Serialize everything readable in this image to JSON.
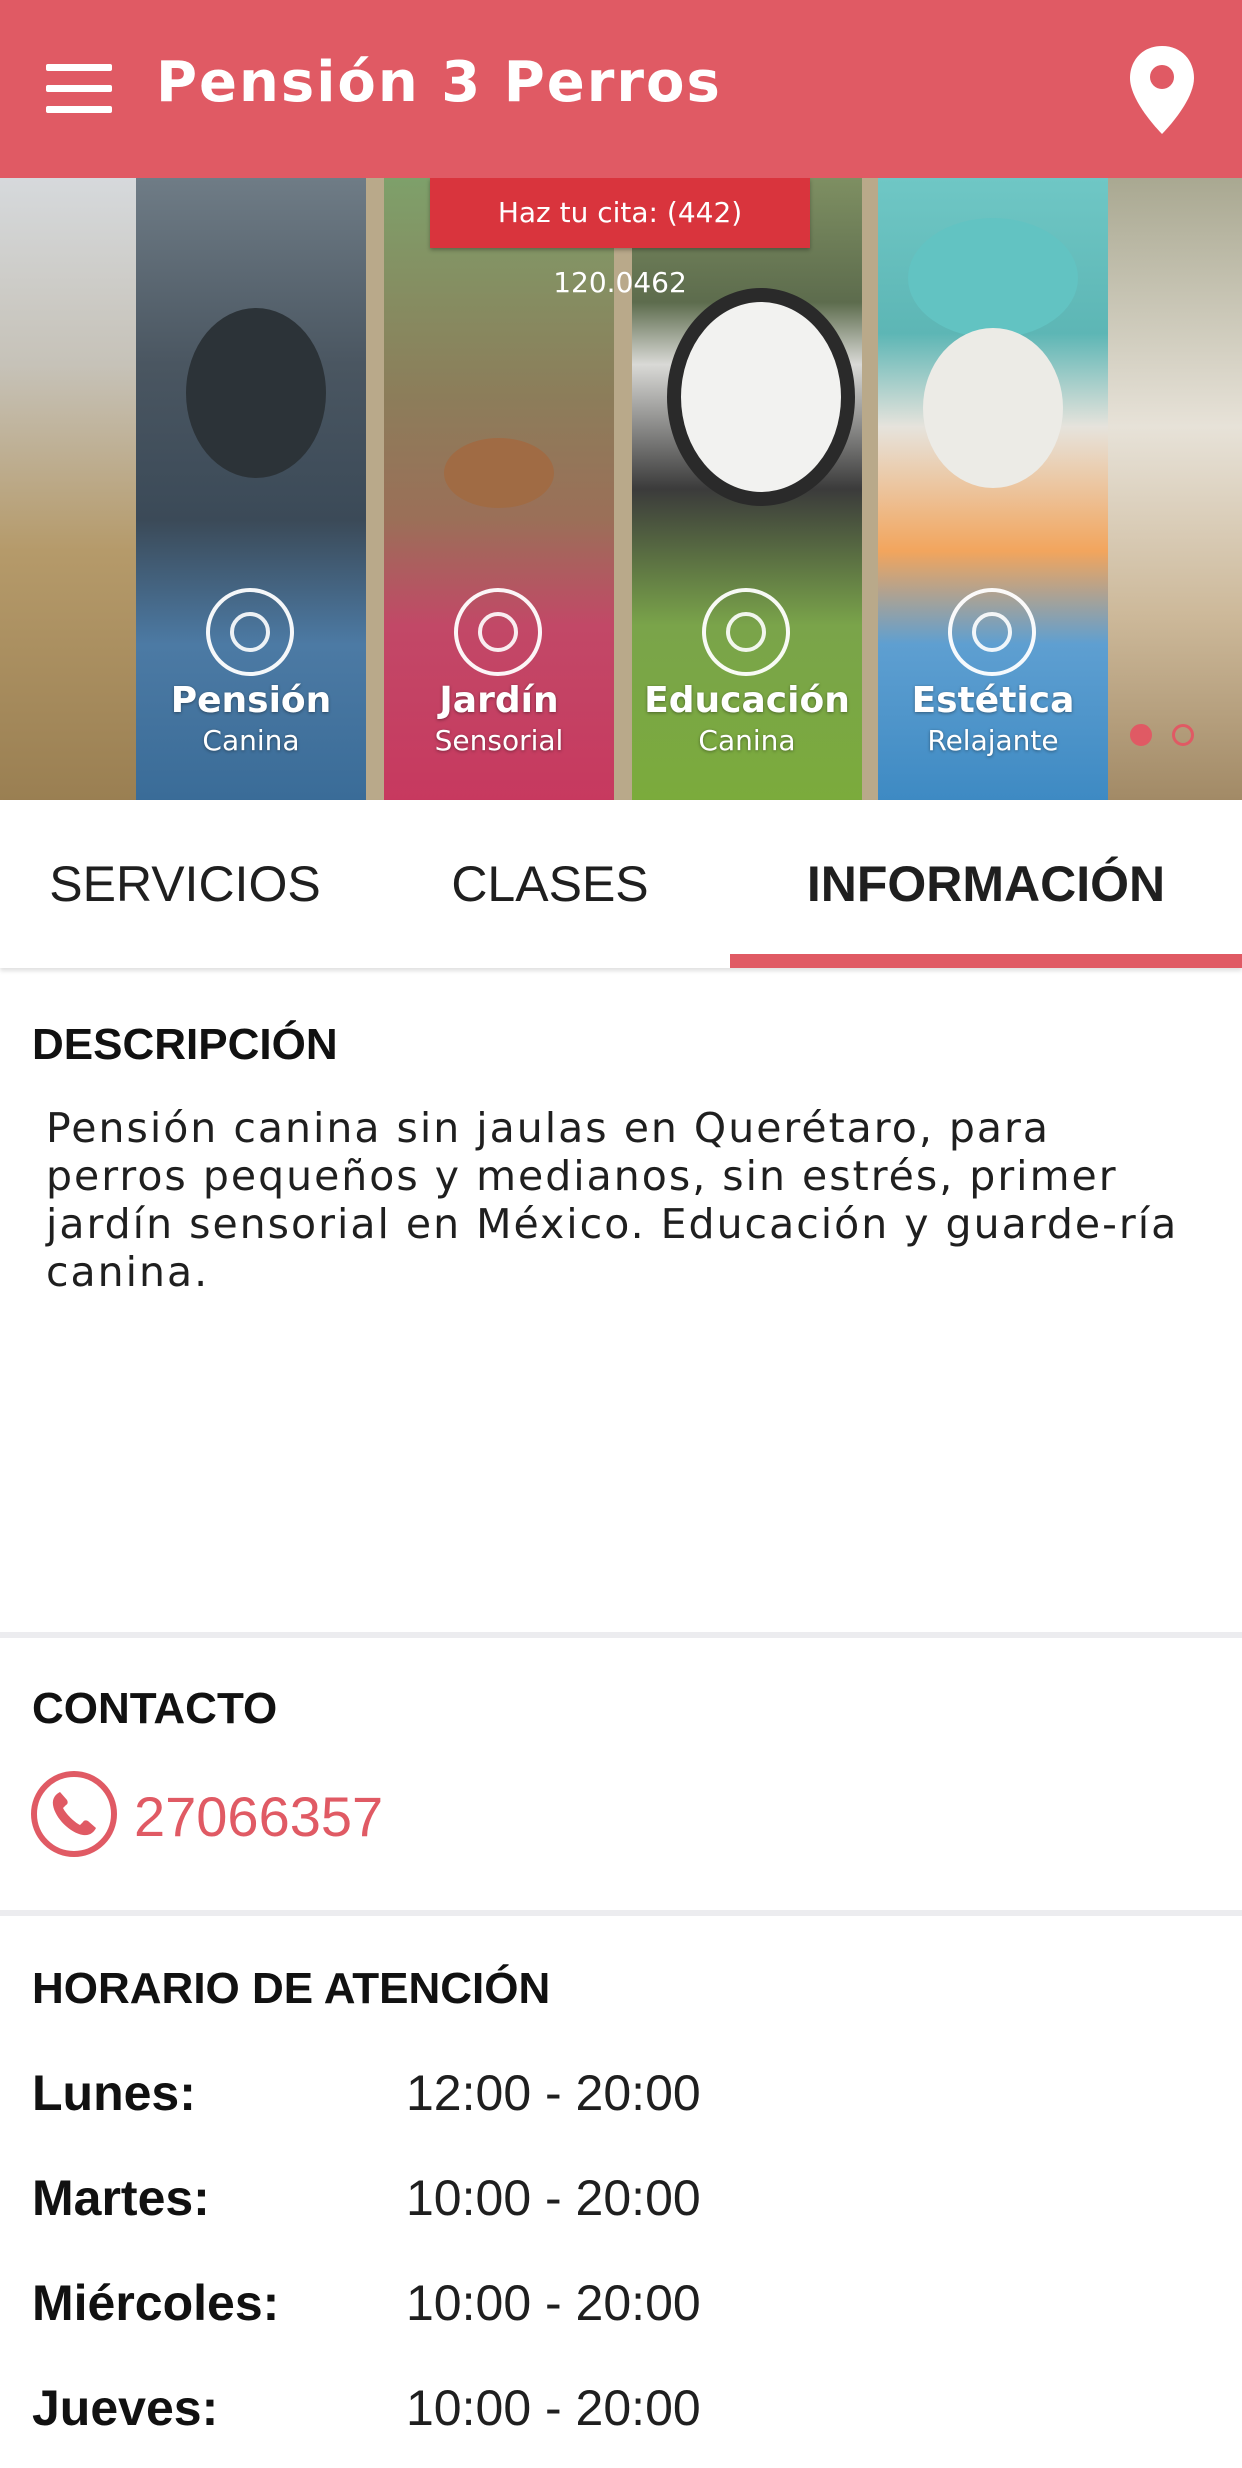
{
  "app_bar": {
    "title": "Pensión 3 Perros",
    "menu_icon": "hamburger-menu-icon",
    "location_icon": "map-pin-icon",
    "color": "#e05a64"
  },
  "banner": {
    "cta_text": "Haz tu cita: (442) 120.0462",
    "panels": [
      {
        "title": "Pensión",
        "subtitle": "Canina"
      },
      {
        "title": "Jardín",
        "subtitle": "Sensorial"
      },
      {
        "title": "Educación",
        "subtitle": "Canina"
      },
      {
        "title": "Estética",
        "subtitle": "Relajante"
      }
    ],
    "pagination": {
      "current": 1,
      "total": 2
    }
  },
  "tabs": [
    {
      "label": "SERVICIOS",
      "active": false
    },
    {
      "label": "CLASES",
      "active": false
    },
    {
      "label": "INFORMACIÓN",
      "active": true
    }
  ],
  "description": {
    "heading": "DESCRIPCIÓN",
    "text": "Pensión canina sin jaulas en Querétaro, para perros pequeños y medianos, sin estrés, primer jardín sensorial en México. Educación y guarde-ría canina."
  },
  "contact": {
    "heading": "CONTACTO",
    "phone": "27066357",
    "phone_icon": "phone-icon"
  },
  "hours": {
    "heading": "HORARIO DE ATENCIÓN",
    "rows": [
      {
        "day": "Lunes:",
        "time": "12:00 - 20:00"
      },
      {
        "day": "Martes:",
        "time": "10:00 - 20:00"
      },
      {
        "day": "Miércoles:",
        "time": "10:00 - 20:00"
      },
      {
        "day": "Jueves:",
        "time": "10:00 - 20:00"
      }
    ]
  }
}
